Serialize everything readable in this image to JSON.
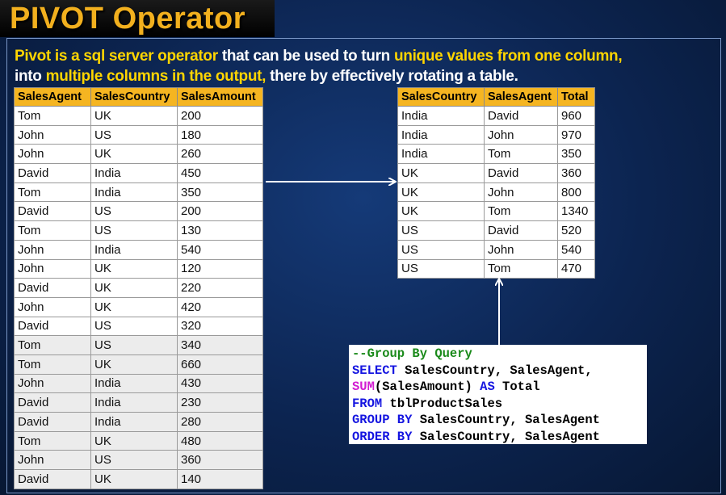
{
  "title": "PIVOT Operator",
  "description": {
    "p1": "Pivot is a sql server operator",
    "p2": " that can be used to turn ",
    "p3": "unique values from one column,",
    "p4": "into ",
    "p5": "multiple columns in the output,",
    "p6": " there by effectively rotating a table."
  },
  "left_table": {
    "headers": [
      "SalesAgent",
      "SalesCountry",
      "SalesAmount"
    ],
    "rows": [
      [
        "Tom",
        "UK",
        "200"
      ],
      [
        "John",
        "US",
        "180"
      ],
      [
        "John",
        "UK",
        "260"
      ],
      [
        "David",
        "India",
        "450"
      ],
      [
        "Tom",
        "India",
        "350"
      ],
      [
        "David",
        "US",
        "200"
      ],
      [
        "Tom",
        "US",
        "130"
      ],
      [
        "John",
        "India",
        "540"
      ],
      [
        "John",
        "UK",
        "120"
      ],
      [
        "David",
        "UK",
        "220"
      ],
      [
        "John",
        "UK",
        "420"
      ],
      [
        "David",
        "US",
        "320"
      ],
      [
        "Tom",
        "US",
        "340"
      ],
      [
        "Tom",
        "UK",
        "660"
      ],
      [
        "John",
        "India",
        "430"
      ],
      [
        "David",
        "India",
        "230"
      ],
      [
        "David",
        "India",
        "280"
      ],
      [
        "Tom",
        "UK",
        "480"
      ],
      [
        "John",
        "US",
        "360"
      ],
      [
        "David",
        "UK",
        "140"
      ]
    ]
  },
  "right_table": {
    "headers": [
      "SalesCountry",
      "SalesAgent",
      "Total"
    ],
    "rows": [
      [
        "India",
        "David",
        "960"
      ],
      [
        "India",
        "John",
        "970"
      ],
      [
        "India",
        "Tom",
        "350"
      ],
      [
        "UK",
        "David",
        "360"
      ],
      [
        "UK",
        "John",
        "800"
      ],
      [
        "UK",
        "Tom",
        "1340"
      ],
      [
        "US",
        "David",
        "520"
      ],
      [
        "US",
        "John",
        "540"
      ],
      [
        "US",
        "Tom",
        "470"
      ]
    ]
  },
  "code": {
    "comment": "--Group By Query",
    "l2_kw": "SELECT",
    "l2_rest": " SalesCountry, SalesAgent,",
    "l3_fn": "SUM",
    "l3_mid": "(SalesAmount) ",
    "l3_kw": "AS",
    "l3_rest": " Total",
    "l4_kw": "FROM",
    "l4_rest": " tblProductSales",
    "l5_kw": "GROUP BY",
    "l5_rest": " SalesCountry, SalesAgent",
    "l6_kw": "ORDER BY",
    "l6_rest": " SalesCountry, SalesAgent"
  },
  "colors": {
    "title": "#f2b01e",
    "highlight": "#ffd500",
    "header_fill": "#f5b521",
    "keyword": "#1515e0",
    "function": "#d21cd2",
    "comment": "#1a8a1a"
  }
}
